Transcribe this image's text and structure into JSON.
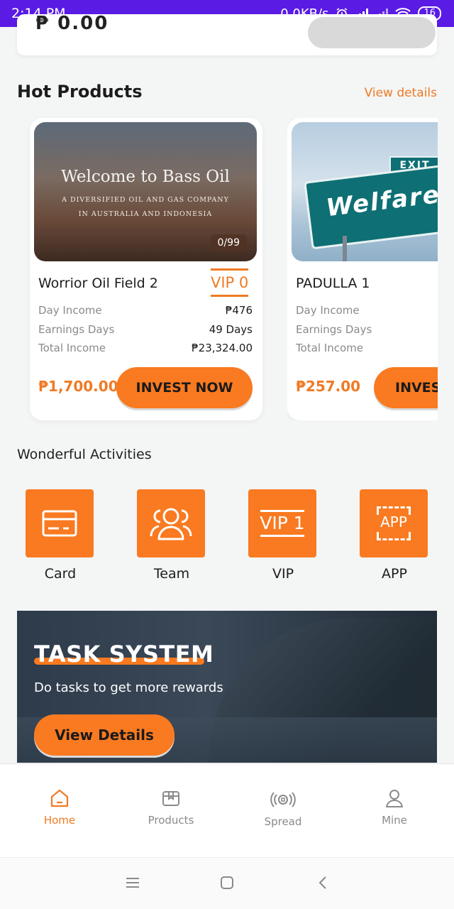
{
  "status_bar": {
    "time": "2:14 PM",
    "net_speed": "0.0KB/s",
    "battery": "16"
  },
  "top_card": {
    "amount_partial": "₱ 0.00"
  },
  "hot_products": {
    "title": "Hot Products",
    "view_details": "View details",
    "items": [
      {
        "image_title": "Welcome to Bass Oil",
        "image_line1": "A DIVERSIFIED OIL AND GAS COMPANY",
        "image_line2": "IN AUSTRALIA AND INDONESIA",
        "stock": "0/99",
        "name": "Worrior Oil Field 2",
        "vip": "VIP 0",
        "day_income_label": "Day Income",
        "day_income": "₱476",
        "earning_days_label": "Earnings Days",
        "earning_days": "49 Days",
        "total_income_label": "Total Income",
        "total_income": "₱23,324.00",
        "price": "₱1,700.00",
        "invest_label": "INVEST NOW"
      },
      {
        "image_sign": "Welfare",
        "image_exit": "EXIT",
        "name": "PADULLA 1",
        "day_income_label": "Day Income",
        "earning_days_label": "Earnings Days",
        "total_income_label": "Total Income",
        "price": "₱257.00",
        "invest_label": "INVEST NOW"
      }
    ]
  },
  "activities": {
    "title": "Wonderful Activities",
    "items": [
      {
        "label": "Card",
        "icon": "card-icon"
      },
      {
        "label": "Team",
        "icon": "team-icon"
      },
      {
        "label": "VIP",
        "icon": "vip-icon",
        "icon_text": "VIP 1"
      },
      {
        "label": "APP",
        "icon": "app-icon",
        "icon_text": "APP"
      }
    ]
  },
  "banner": {
    "title": "TASK SYSTEM",
    "subtitle": "Do tasks to get more rewards",
    "button": "View Details"
  },
  "bottom_nav": {
    "items": [
      {
        "label": "Home",
        "icon": "home-icon",
        "active": true
      },
      {
        "label": "Products",
        "icon": "box-icon"
      },
      {
        "label": "Spread",
        "icon": "spread-icon"
      },
      {
        "label": "Mine",
        "icon": "user-icon"
      }
    ]
  },
  "colors": {
    "accent": "#f97a20",
    "status_bar": "#5a1be4"
  }
}
